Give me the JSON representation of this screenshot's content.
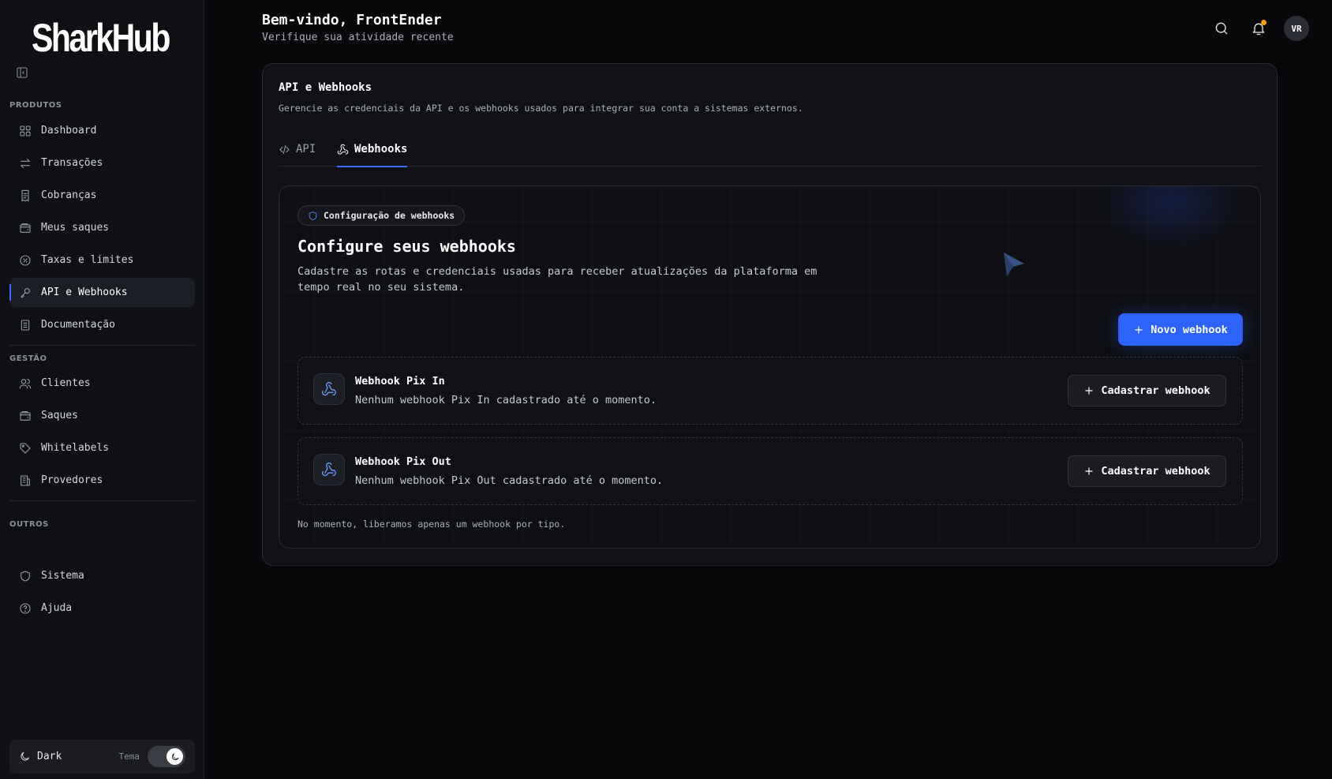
{
  "sidebar": {
    "logo_text": "SharkHub",
    "sections": {
      "produtos": "PRODUTOS",
      "gestao": "GESTÃO",
      "outros": "OUTROS"
    },
    "items": {
      "dashboard": "Dashboard",
      "transacoes": "Transações",
      "cobrancas": "Cobranças",
      "saques_meus": "Meus saques",
      "taxas": "Taxas e limites",
      "api": "API e Webhooks",
      "docs": "Documentação",
      "clientes": "Clientes",
      "saques": "Saques",
      "whitelabels": "Whitelabels",
      "provedores": "Provedores",
      "sistema": "Sistema",
      "ajuda": "Ajuda"
    },
    "theme": {
      "label": "Dark",
      "tema": "Tema"
    }
  },
  "header": {
    "title": "Bem-vindo, FrontEnder",
    "subtitle": "Verifique sua atividade recente",
    "avatar": "VR"
  },
  "card": {
    "title": "API e Webhooks",
    "subtitle": "Gerencie as credenciais da API e os webhooks usados para integrar sua conta a sistemas externos.",
    "tabs": {
      "api": "API",
      "webhooks": "Webhooks"
    },
    "inner": {
      "badge": "Configuração de webhooks",
      "title": "Configure seus webhooks",
      "description": "Cadastre as rotas e credenciais usadas para receber atualizações da plataforma em tempo real no seu sistema.",
      "new_button": "Novo webhook",
      "hooks": [
        {
          "title": "Webhook Pix In",
          "text": "Nenhum webhook Pix In cadastrado até o momento.",
          "button": "Cadastrar webhook"
        },
        {
          "title": "Webhook Pix Out",
          "text": "Nenhum webhook Pix Out cadastrado até o momento.",
          "button": "Cadastrar webhook"
        }
      ],
      "footnote": "No momento, liberamos apenas um webhook por tipo."
    }
  },
  "colors": {
    "accent": "#2d63f6",
    "background": "#08080a",
    "notification": "#f59e0b"
  }
}
